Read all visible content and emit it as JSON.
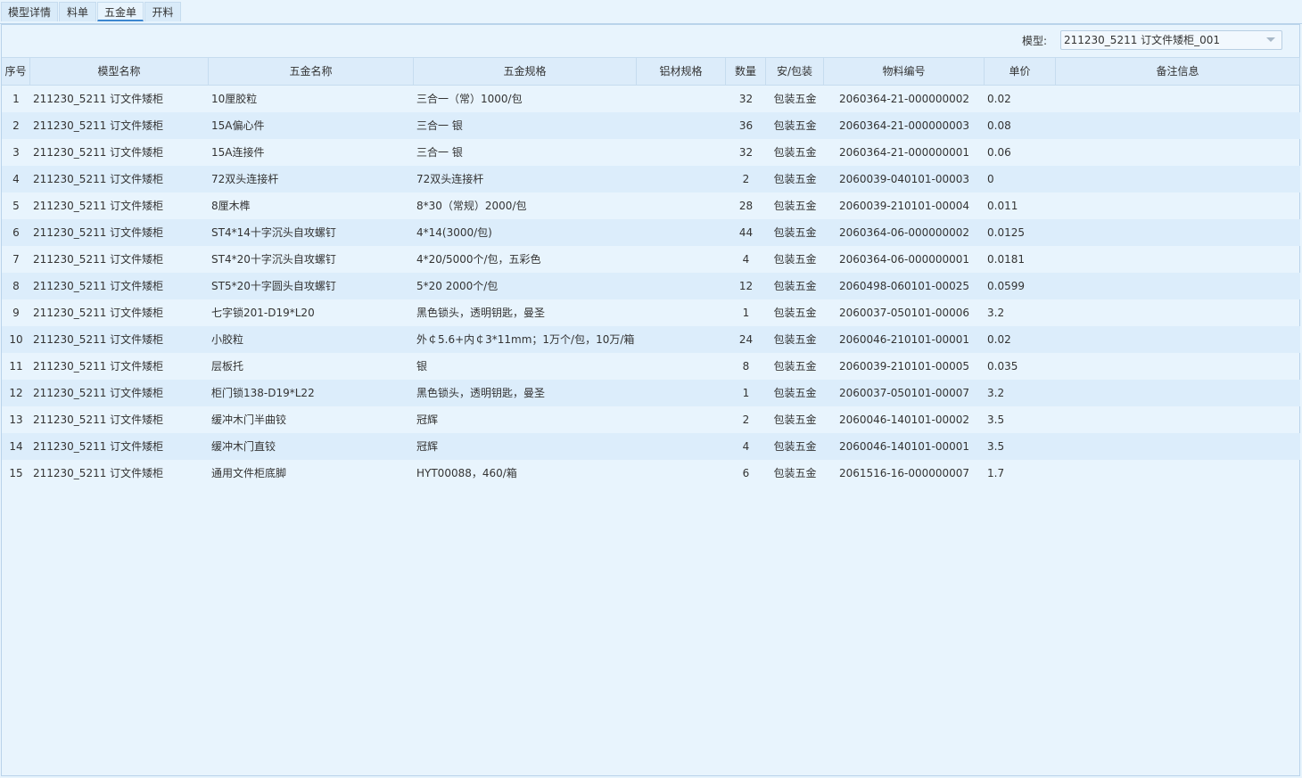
{
  "tabs": [
    {
      "label": "模型详情",
      "active": false
    },
    {
      "label": "料单",
      "active": false
    },
    {
      "label": "五金单",
      "active": true
    },
    {
      "label": "开料",
      "active": false
    }
  ],
  "filter": {
    "model_label": "模型:",
    "model_value": "211230_5211 订文件矮柜_001"
  },
  "table": {
    "columns": [
      "序号",
      "模型名称",
      "五金名称",
      "五金规格",
      "铝材规格",
      "数量",
      "安/包装",
      "物料编号",
      "单价",
      "备注信息"
    ],
    "rows": [
      {
        "idx": "1",
        "model": "211230_5211 订文件矮柜",
        "name": "10厘胶粒",
        "spec": "三合一（常）1000/包",
        "al": "",
        "qty": "32",
        "pack": "包装五金",
        "code": "2060364-21-000000002",
        "price": "0.02",
        "note": ""
      },
      {
        "idx": "2",
        "model": "211230_5211 订文件矮柜",
        "name": "15A偏心件",
        "spec": "三合一 银",
        "al": "",
        "qty": "36",
        "pack": "包装五金",
        "code": "2060364-21-000000003",
        "price": "0.08",
        "note": ""
      },
      {
        "idx": "3",
        "model": "211230_5211 订文件矮柜",
        "name": "15A连接件",
        "spec": "三合一 银",
        "al": "",
        "qty": "32",
        "pack": "包装五金",
        "code": "2060364-21-000000001",
        "price": "0.06",
        "note": ""
      },
      {
        "idx": "4",
        "model": "211230_5211 订文件矮柜",
        "name": "72双头连接杆",
        "spec": "72双头连接杆",
        "al": "",
        "qty": "2",
        "pack": "包装五金",
        "code": "2060039-040101-00003",
        "price": "0",
        "note": ""
      },
      {
        "idx": "5",
        "model": "211230_5211 订文件矮柜",
        "name": "8厘木榫",
        "spec": "8*30（常规）2000/包",
        "al": "",
        "qty": "28",
        "pack": "包装五金",
        "code": "2060039-210101-00004",
        "price": "0.011",
        "note": ""
      },
      {
        "idx": "6",
        "model": "211230_5211 订文件矮柜",
        "name": "ST4*14十字沉头自攻螺钉",
        "spec": "4*14(3000/包)",
        "al": "",
        "qty": "44",
        "pack": "包装五金",
        "code": "2060364-06-000000002",
        "price": "0.0125",
        "note": ""
      },
      {
        "idx": "7",
        "model": "211230_5211 订文件矮柜",
        "name": "ST4*20十字沉头自攻螺钉",
        "spec": "4*20/5000个/包，五彩色",
        "al": "",
        "qty": "4",
        "pack": "包装五金",
        "code": "2060364-06-000000001",
        "price": "0.0181",
        "note": ""
      },
      {
        "idx": "8",
        "model": "211230_5211 订文件矮柜",
        "name": "ST5*20十字圆头自攻螺钉",
        "spec": "5*20 2000个/包",
        "al": "",
        "qty": "12",
        "pack": "包装五金",
        "code": "2060498-060101-00025",
        "price": "0.0599",
        "note": ""
      },
      {
        "idx": "9",
        "model": "211230_5211 订文件矮柜",
        "name": "七字锁201-D19*L20",
        "spec": "黑色锁头，透明钥匙，曼圣",
        "al": "",
        "qty": "1",
        "pack": "包装五金",
        "code": "2060037-050101-00006",
        "price": "3.2",
        "note": ""
      },
      {
        "idx": "10",
        "model": "211230_5211 订文件矮柜",
        "name": "小胶粒",
        "spec": "外￠5.6+内￠3*11mm；1万个/包，10万/箱",
        "al": "",
        "qty": "24",
        "pack": "包装五金",
        "code": "2060046-210101-00001",
        "price": "0.02",
        "note": ""
      },
      {
        "idx": "11",
        "model": "211230_5211 订文件矮柜",
        "name": "层板托",
        "spec": "银",
        "al": "",
        "qty": "8",
        "pack": "包装五金",
        "code": "2060039-210101-00005",
        "price": "0.035",
        "note": ""
      },
      {
        "idx": "12",
        "model": "211230_5211 订文件矮柜",
        "name": "柜门锁138-D19*L22",
        "spec": "黑色锁头，透明钥匙，曼圣",
        "al": "",
        "qty": "1",
        "pack": "包装五金",
        "code": "2060037-050101-00007",
        "price": "3.2",
        "note": ""
      },
      {
        "idx": "13",
        "model": "211230_5211 订文件矮柜",
        "name": "缓冲木门半曲铰",
        "spec": "冠辉",
        "al": "",
        "qty": "2",
        "pack": "包装五金",
        "code": "2060046-140101-00002",
        "price": "3.5",
        "note": ""
      },
      {
        "idx": "14",
        "model": "211230_5211 订文件矮柜",
        "name": "缓冲木门直铰",
        "spec": "冠辉",
        "al": "",
        "qty": "4",
        "pack": "包装五金",
        "code": "2060046-140101-00001",
        "price": "3.5",
        "note": ""
      },
      {
        "idx": "15",
        "model": "211230_5211 订文件矮柜",
        "name": "通用文件柜底脚",
        "spec": "HYT00088，460/箱",
        "al": "",
        "qty": "6",
        "pack": "包装五金",
        "code": "2061516-16-000000007",
        "price": "1.7",
        "note": ""
      }
    ]
  }
}
